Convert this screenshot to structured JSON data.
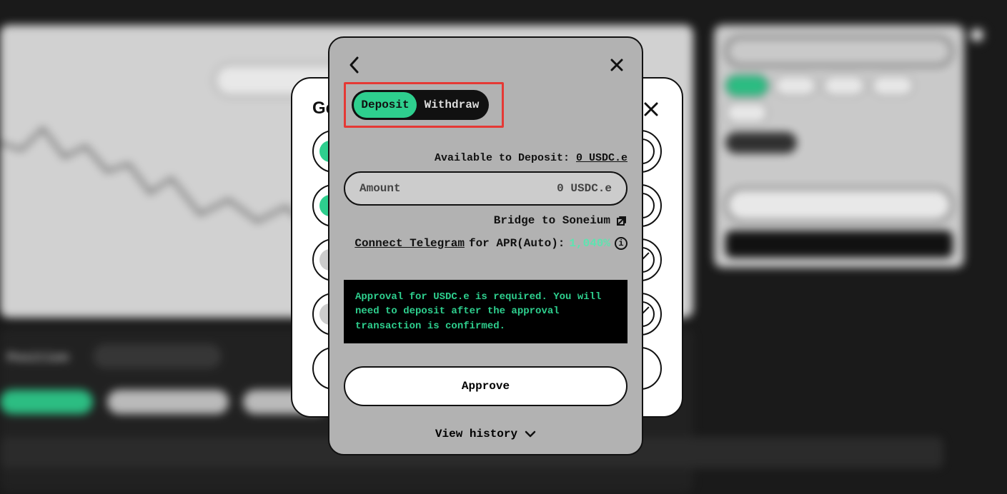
{
  "colors": {
    "accent": "#2ecf8e",
    "highlight_border": "#e53935",
    "modal_gray": "#b2b2b2"
  },
  "background": {
    "positions_label": "Position",
    "behind_modal_title_prefix": "Get"
  },
  "modal": {
    "segments": {
      "deposit": "Deposit",
      "withdraw": "Withdraw"
    },
    "available_label": "Available to Deposit: ",
    "available_value": "0 USDC.e",
    "amount_placeholder": "Amount",
    "amount_value": "0",
    "amount_currency": "USDC.e",
    "bridge_label": "Bridge to Soneium",
    "apr": {
      "connect_label": "Connect Telegram",
      "suffix": " for APR(Auto): ",
      "rate": "1,040%"
    },
    "notice": "Approval for USDC.e is required. You will need to deposit after the approval transaction is confirmed.",
    "approve_button": "Approve",
    "view_history": "View history"
  }
}
